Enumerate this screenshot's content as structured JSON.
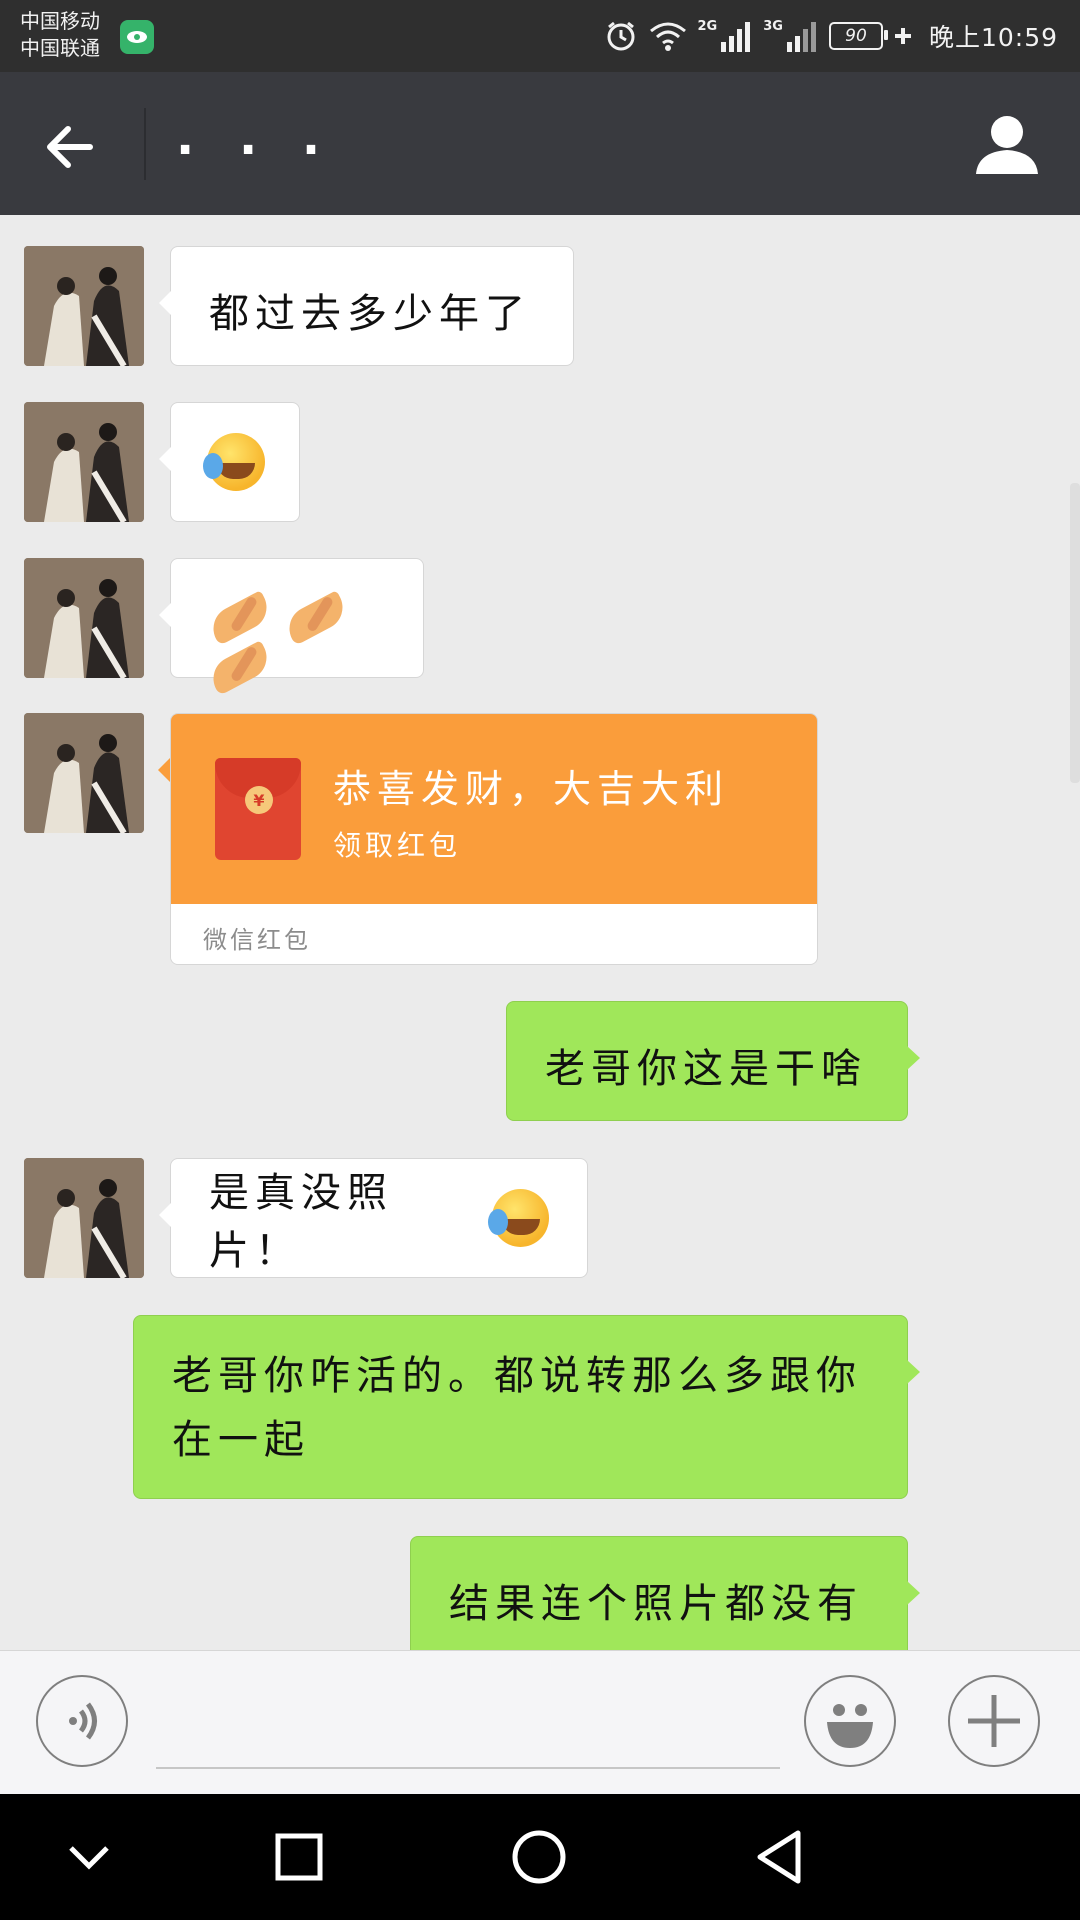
{
  "status_bar": {
    "carrier_1": "中国移动",
    "carrier_2": "中国联通",
    "network_1": "2G",
    "network_2": "3G",
    "battery": "90",
    "time": "晚上10:59"
  },
  "header": {
    "title": ". . ."
  },
  "messages": [
    {
      "side": "in",
      "text": "都过去多少年了"
    },
    {
      "side": "in",
      "emoji": "face-with-tears-icon"
    },
    {
      "side": "in",
      "emoji": "pinched-hands-icon x3"
    },
    {
      "side": "in",
      "red_packet": {
        "title": "恭喜发财，大吉大利",
        "action": "领取红包",
        "label": "微信红包"
      }
    },
    {
      "side": "out",
      "text": "老哥你这是干啥"
    },
    {
      "side": "in",
      "text": "是真没照片！"
    },
    {
      "side": "out",
      "text_line1": "老哥你咋活的。都说转那么多跟你",
      "text_line2": "在一起"
    },
    {
      "side": "out",
      "text": "结果连个照片都没有"
    }
  ],
  "colors": {
    "header_bg": "#393a3f",
    "chat_bg": "#ebebeb",
    "bubble_out": "#a0e75a",
    "bubble_in": "#ffffff",
    "red_packet": "#fa9d3b"
  }
}
